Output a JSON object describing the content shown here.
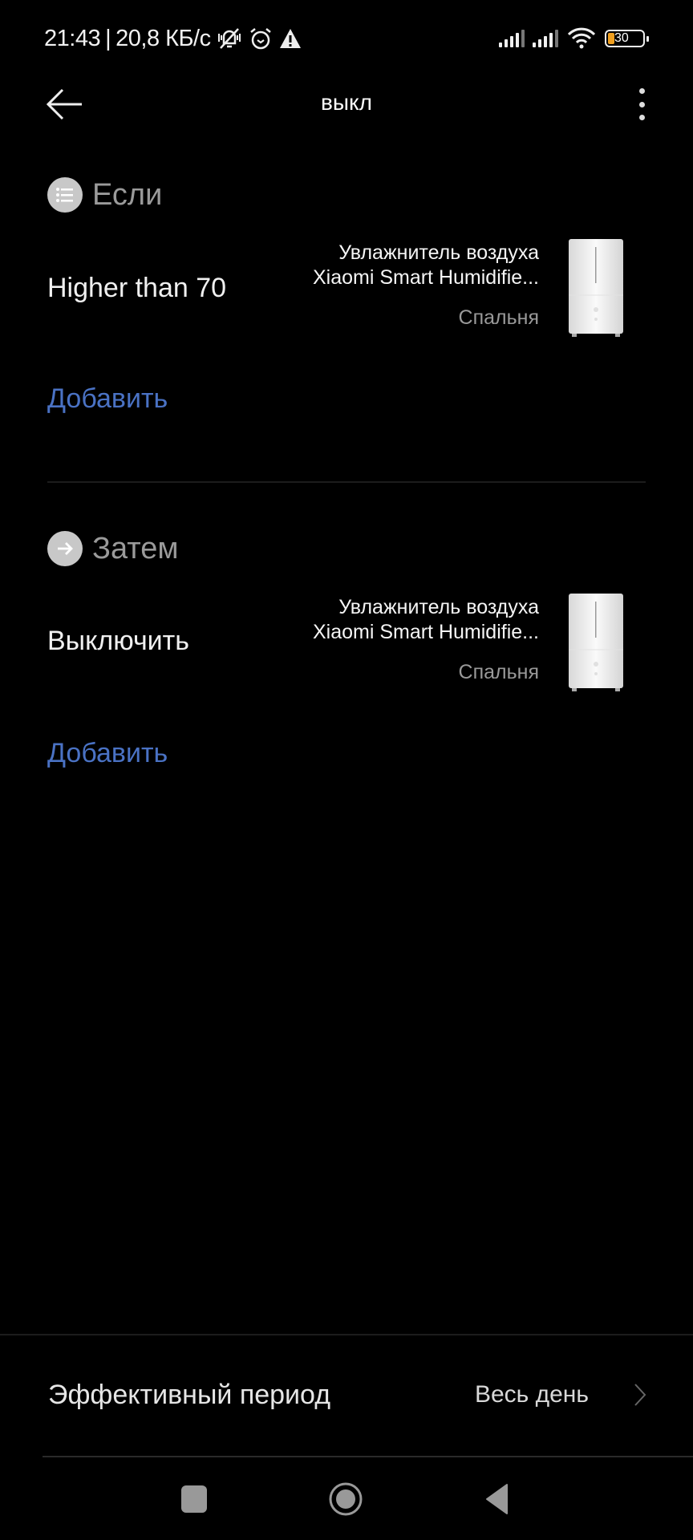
{
  "status_bar": {
    "time": "21:43",
    "separator": "|",
    "network_speed": "20,8 КБ/с",
    "icons": [
      "vibrate-muted-icon",
      "alarm-icon",
      "warning-icon"
    ],
    "right_icons": [
      "signal-sim1-icon",
      "signal-sim2-icon",
      "wifi-icon",
      "battery-icon"
    ],
    "battery_level": "30",
    "battery_color": "#f0a020"
  },
  "header": {
    "back_icon": "arrow-left-icon",
    "title": "выкл",
    "menu_icon": "more-vertical-icon"
  },
  "if_section": {
    "label": "Если",
    "icon": "list-icon",
    "condition": {
      "text": "Higher than 70",
      "device_line1": "Увлажнитель воздуха",
      "device_line2": "Xiaomi Smart Humidifie...",
      "room": "Спальня",
      "image": "humidifier-image"
    },
    "add_label": "Добавить"
  },
  "then_section": {
    "label": "Затем",
    "icon": "arrow-right-icon",
    "action": {
      "text": "Выключить",
      "device_line1": "Увлажнитель воздуха",
      "device_line2": "Xiaomi Smart Humidifie...",
      "room": "Спальня",
      "image": "humidifier-image"
    },
    "add_label": "Добавить"
  },
  "effective_period": {
    "label": "Эффективный период",
    "value": "Весь день"
  },
  "nav_bar": {
    "buttons": [
      "recents-button",
      "home-button",
      "back-button"
    ]
  },
  "colors": {
    "accent": "#4a72c4",
    "background": "#000000",
    "section_label": "#9a9a9a",
    "secondary_text": "#999999"
  }
}
